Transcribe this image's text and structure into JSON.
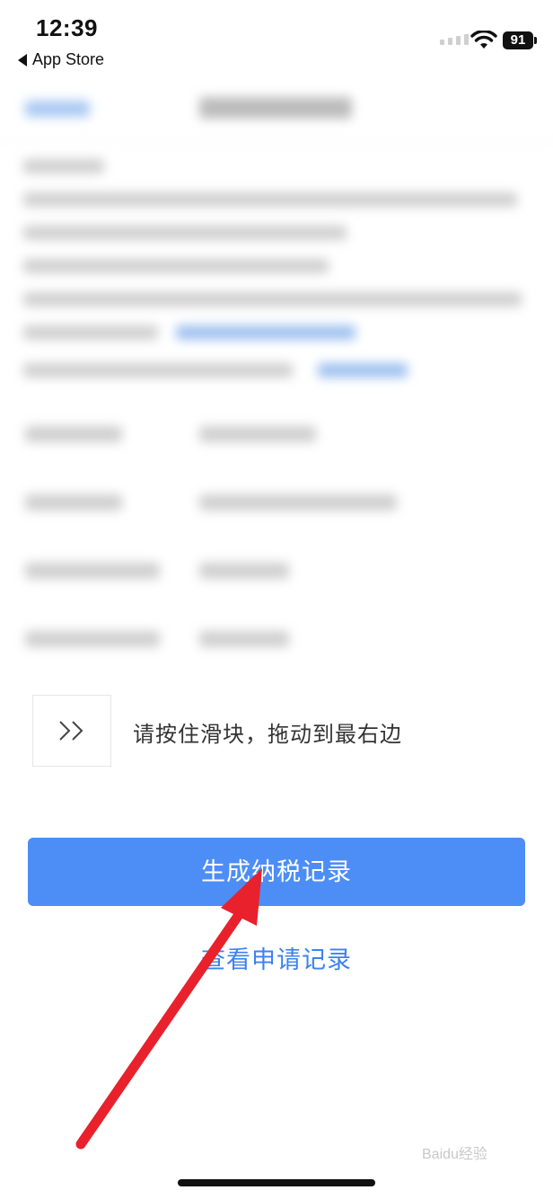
{
  "status_bar": {
    "time": "12:39",
    "back_app": "App Store",
    "battery": "91"
  },
  "slider": {
    "handle_icon": "double-chevron-right-icon",
    "instruction": "请按住滑块，拖动到最右边"
  },
  "actions": {
    "primary_label": "生成纳税记录",
    "secondary_label": "查看申请记录"
  },
  "watermark": "Baidu经验",
  "colors": {
    "primary": "#4c8ef6",
    "link": "#3b82f0",
    "annotation_arrow": "#e8212c"
  }
}
